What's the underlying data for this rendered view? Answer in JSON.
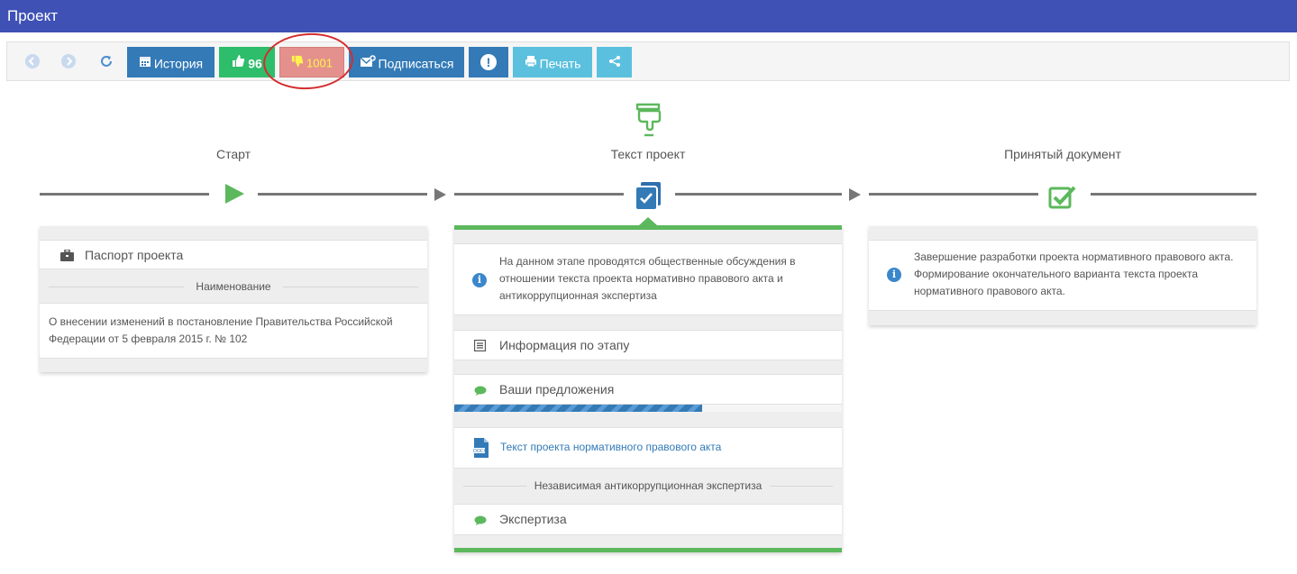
{
  "header": {
    "title": "Проект"
  },
  "toolbar": {
    "history_label": "История",
    "likes_count": "96",
    "dislikes_count": "1001",
    "subscribe_label": "Подписаться",
    "alert_label": "!",
    "print_label": "Печать"
  },
  "colors": {
    "header": "#3f51b5",
    "button_blue": "#337ab7",
    "button_green": "#2ebd6b",
    "button_red": "#e4918d",
    "button_cyan": "#5bc0de",
    "stage_green": "#5cb85c"
  },
  "stages": [
    {
      "title": "Старт",
      "icon": "play-icon"
    },
    {
      "title": "Текст проект",
      "icon": "document-check-icon",
      "top_icon": "pointing-hand-icon"
    },
    {
      "title": "Принятый документ",
      "icon": "checkbox-icon"
    }
  ],
  "start_panel": {
    "passport_label": "Паспорт проекта",
    "name_header": "Наименование",
    "name_value": "О внесении изменений в постановление Правительства Российской Федерации от 5 февраля 2015 г. № 102"
  },
  "text_panel": {
    "info": "На данном этапе проводятся общественные обсуждения в отношении текста проекта нормативно правового акта и антикоррупционная экспертиза",
    "stage_info_label": "Информация по этапу",
    "suggestions_label": "Ваши предложения",
    "progress": 0.64,
    "document_link": "Текст проекта нормативного правового акта",
    "expertise_header": "Независимая антикоррупционная экспертиза",
    "expertise_label": "Экспертиза"
  },
  "final_panel": {
    "info": "Завершение разработки проекта нормативного правового акта. Формирование окончательного варианта текста проекта нормативного правового акта."
  }
}
